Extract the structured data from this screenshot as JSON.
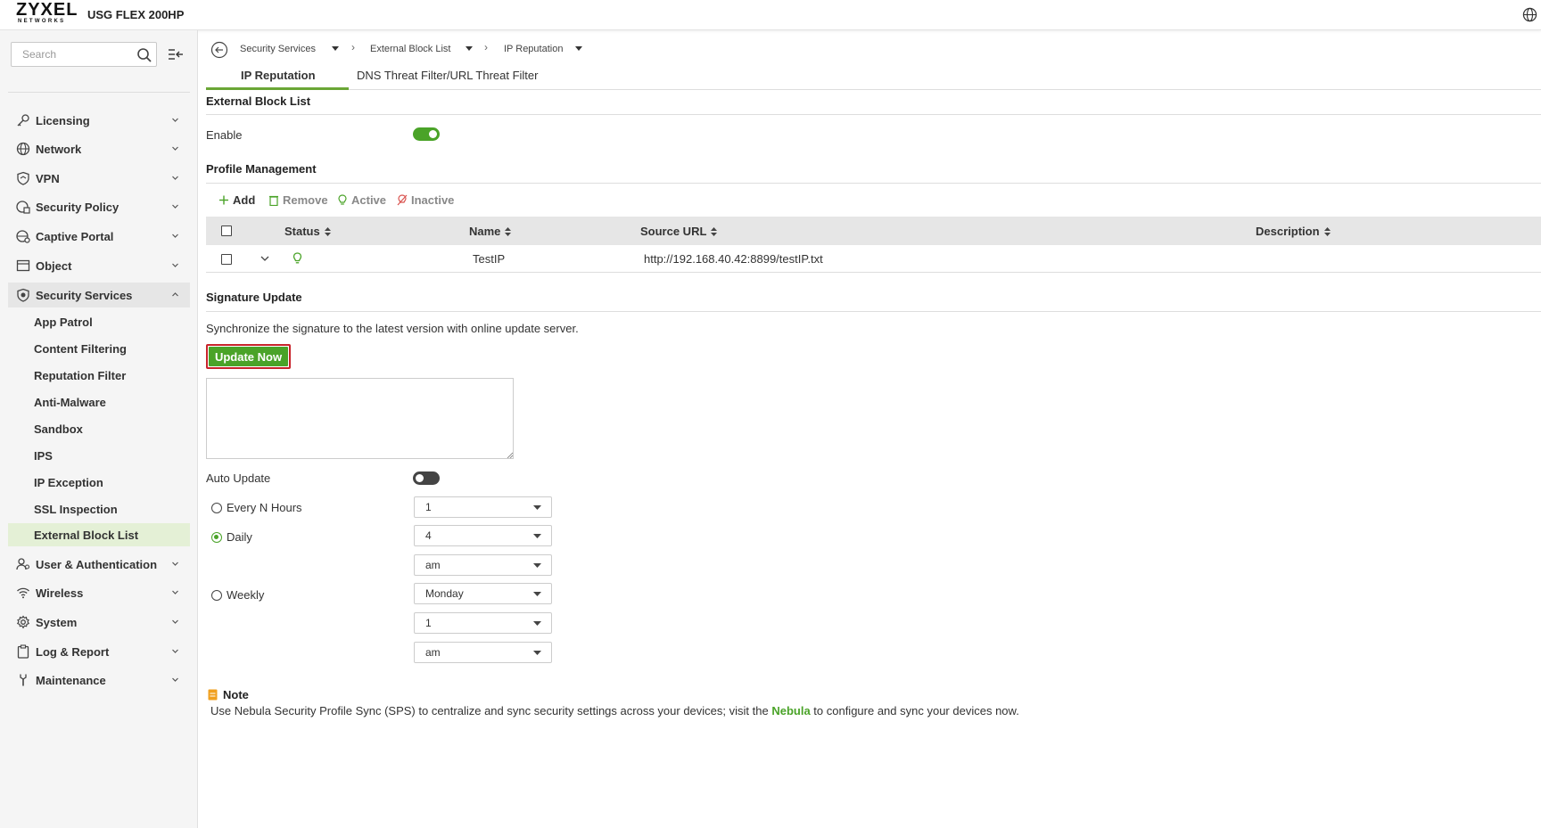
{
  "header": {
    "brand": "ZYXEL",
    "brand_sub": "NETWORKS",
    "model": "USG FLEX 200HP"
  },
  "sidebar": {
    "search_placeholder": "Search",
    "items": [
      {
        "label": "Licensing",
        "icon": "key-icon"
      },
      {
        "label": "Network",
        "icon": "globe-icon"
      },
      {
        "label": "VPN",
        "icon": "shield-vpn-icon"
      },
      {
        "label": "Security Policy",
        "icon": "security-policy-icon"
      },
      {
        "label": "Captive Portal",
        "icon": "captive-portal-icon"
      },
      {
        "label": "Object",
        "icon": "object-icon"
      },
      {
        "label": "Security Services",
        "icon": "shield-icon"
      },
      {
        "label": "User & Authentication",
        "icon": "user-icon"
      },
      {
        "label": "Wireless",
        "icon": "wifi-icon"
      },
      {
        "label": "System",
        "icon": "gear-icon"
      },
      {
        "label": "Log & Report",
        "icon": "clipboard-icon"
      },
      {
        "label": "Maintenance",
        "icon": "wrench-icon"
      }
    ],
    "security_services_sub": [
      "App Patrol",
      "Content Filtering",
      "Reputation Filter",
      "Anti-Malware",
      "Sandbox",
      "IPS",
      "IP Exception",
      "SSL Inspection",
      "External Block List"
    ]
  },
  "breadcrumb": [
    "Security Services",
    "External Block List",
    "IP Reputation"
  ],
  "tabs": [
    "IP Reputation",
    "DNS Threat Filter/URL Threat Filter"
  ],
  "ebl": {
    "section_title": "External Block List",
    "enable_label": "Enable",
    "enable_state": "on"
  },
  "profile": {
    "section_title": "Profile Management",
    "toolbar": {
      "add": "Add",
      "remove": "Remove",
      "active": "Active",
      "inactive": "Inactive"
    },
    "columns": {
      "status": "Status",
      "name": "Name",
      "source_url": "Source URL",
      "description": "Description"
    },
    "rows": [
      {
        "status": "active",
        "name": "TestIP",
        "source_url": "http://192.168.40.42:8899/testIP.txt",
        "description": ""
      }
    ]
  },
  "signature": {
    "section_title": "Signature Update",
    "description": "Synchronize the signature to the latest version with online update server.",
    "update_button": "Update Now",
    "auto_update_label": "Auto Update",
    "auto_update_state": "off",
    "every_n_hours_label": "Every N Hours",
    "every_n_hours_value": "1",
    "daily_label": "Daily",
    "daily_hour": "4",
    "daily_ampm": "am",
    "weekly_label": "Weekly",
    "weekly_day": "Monday",
    "weekly_hour": "1",
    "weekly_ampm": "am",
    "selected": "Daily"
  },
  "note": {
    "title": "Note",
    "text_before": "Use Nebula Security Profile Sync (SPS) to centralize and sync security settings across your devices; visit the ",
    "link": "Nebula",
    "text_after": " to configure and sync your devices now."
  },
  "colors": {
    "accent": "#4aa328",
    "highlight_border": "#c8242c",
    "active_sub_bg": "#e4f0d6"
  }
}
